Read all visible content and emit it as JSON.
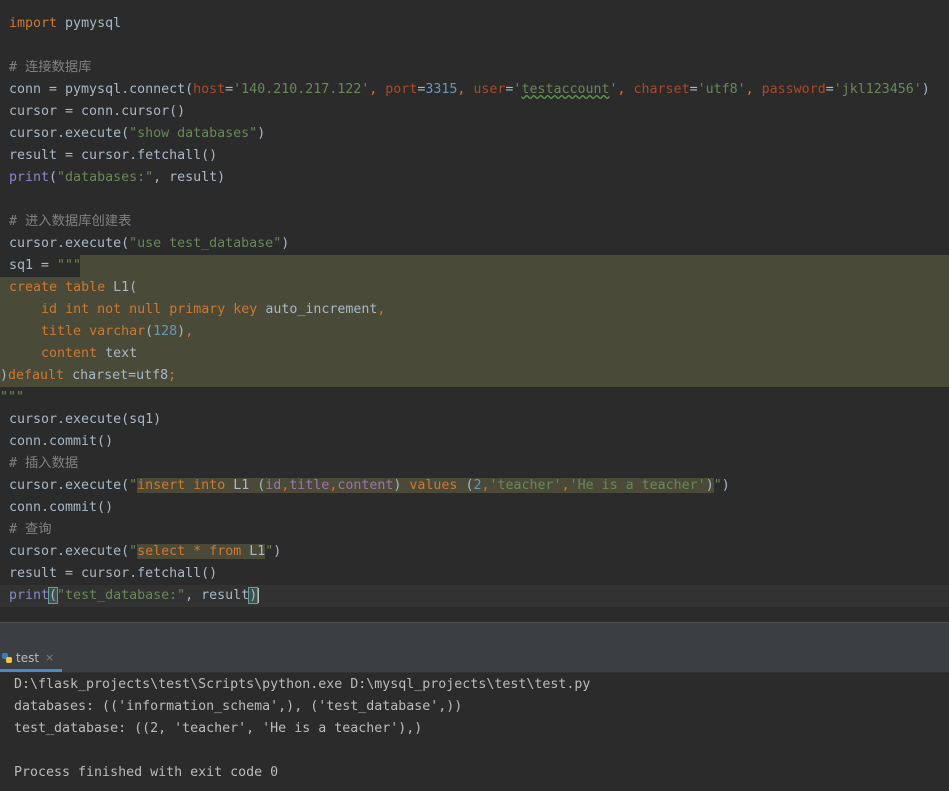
{
  "editor": {
    "l1_import": "import",
    "l1_mod": " pymysql",
    "l3_comment": "# 连接数据库",
    "l4_a": "conn = pymysql.connect(",
    "l4_host_k": "host",
    "l4_eq": "=",
    "l4_host_v": "'140.210.217.122'",
    "l4_c1": ", ",
    "l4_port_k": "port",
    "l4_port_v": "3315",
    "l4_user_k": "user",
    "l4_user_q1": "'",
    "l4_user_v": "testaccount",
    "l4_user_q2": "'",
    "l4_charset_k": "charset",
    "l4_charset_v": "'utf8'",
    "l4_pw_k": "password",
    "l4_pw_v": "'jkl123456'",
    "l4_end": ")",
    "l5": "cursor = conn.cursor()",
    "l6_a": "cursor.execute(",
    "l6_s": "\"show databases\"",
    "l6_b": ")",
    "l7": "result = cursor.fetchall()",
    "l8_print": "print",
    "l8_a": "(",
    "l8_s": "\"databases:\"",
    "l8_b": ", result)",
    "l10_comment": "# 进入数据库创建表",
    "l11_a": "cursor.execute(",
    "l11_s": "\"use test_database\"",
    "l11_b": ")",
    "l12_a": "sq1 = ",
    "l12_s": "\"\"\"",
    "l13_kw1": "create",
    "l13_kw2": "table",
    "l13_name": "L1(",
    "l14_col": "id",
    "l14_int": "int",
    "l14_not": "not",
    "l14_null": "null",
    "l14_pk1": "primary",
    "l14_pk2": "key",
    "l14_ai": "auto_increment",
    "l14_comma": ",",
    "l15_col": "title",
    "l15_type": "varchar",
    "l15_p1": "(",
    "l15_num": "128",
    "l15_p2": ")",
    "l15_comma": ",",
    "l16_col": "content",
    "l16_type": "text",
    "l17_p": ")",
    "l17_default": "default",
    "l17_charset": "charset=utf8",
    "l17_semi": ";",
    "l18_s": "\"\"\"",
    "l19": "cursor.execute(sq1)",
    "l20": "conn.commit()",
    "l21_comment": "# 插入数据",
    "l22_a": "cursor.execute(",
    "l22_q": "\"",
    "l22_insert": "insert",
    "l22_into": "into",
    "l22_tbl": "L1 (",
    "l22_c1": "id",
    "l22_cm1": ",",
    "l22_c2": "title",
    "l22_cm2": ",",
    "l22_c3": "content",
    "l22_close": ")",
    "l22_values": "values",
    "l22_op": "(",
    "l22_n": "2",
    "l22_cm3": ",",
    "l22_v1": "'teacher'",
    "l22_cm4": ",",
    "l22_v2": "'He is a teacher'",
    "l22_cp": ")",
    "l22_q2": "\"",
    "l22_b": ")",
    "l23": "conn.commit()",
    "l24_comment": "# 查询",
    "l25_a": "cursor.execute(",
    "l25_q": "\"",
    "l25_select": "select",
    "l25_star": "*",
    "l25_from": "from",
    "l25_tbl": "L1",
    "l25_q2": "\"",
    "l25_b": ")",
    "l26": "result = cursor.fetchall()",
    "l27_print": "print",
    "l27_p1": "(",
    "l27_s": "\"test_database:\"",
    "l27_mid": ", result",
    "l27_p2": ")"
  },
  "run_tab": {
    "label": "test",
    "close": "×"
  },
  "console": {
    "line1": "D:\\flask_projects\\test\\Scripts\\python.exe D:\\mysql_projects\\test\\test.py",
    "line2": "databases: (('information_schema',), ('test_database',))",
    "line3": "test_database: ((2, 'teacher', 'He is a teacher'),)",
    "line5": "Process finished with exit code 0"
  },
  "colors": {
    "keyword": "#cc7832",
    "string": "#6a8759",
    "number": "#6897bb",
    "comment": "#808080",
    "param": "#aa4926",
    "builtin": "#8888c6",
    "highlight": "#4a4a38"
  },
  "icons": {
    "tab_icon": "python-icon",
    "tab_close": "close-icon"
  }
}
